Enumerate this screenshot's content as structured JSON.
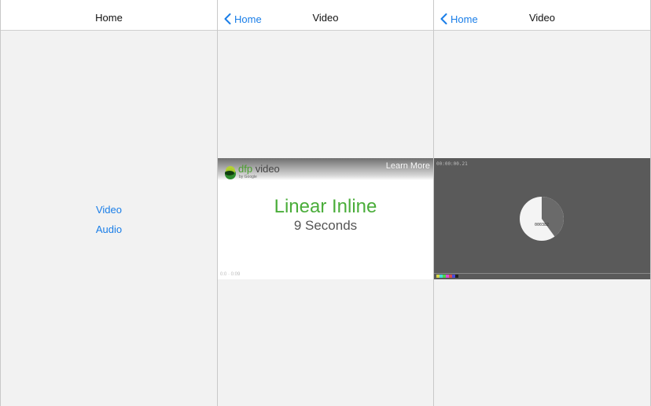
{
  "screen_home": {
    "title": "Home",
    "menu": [
      {
        "label": "Video"
      },
      {
        "label": "Audio"
      }
    ]
  },
  "screen_video_ad": {
    "back_label": "Home",
    "title": "Video",
    "ad": {
      "brand": "dfp",
      "brand_suffix": "video",
      "brand_sub": "by Google",
      "learn_more": "Learn More",
      "headline": "Linear Inline",
      "subline": "9 Seconds",
      "timer": "0:0 · 0:09"
    }
  },
  "screen_video_content": {
    "back_label": "Home",
    "title": "Video",
    "player": {
      "timecode": "00:00:00.21",
      "counter": "000382",
      "progress_fraction": 0.6
    }
  },
  "colors": {
    "accent": "#1a7ee8",
    "ad_green": "#4aad3a",
    "player_bg": "#5a5a5a"
  }
}
